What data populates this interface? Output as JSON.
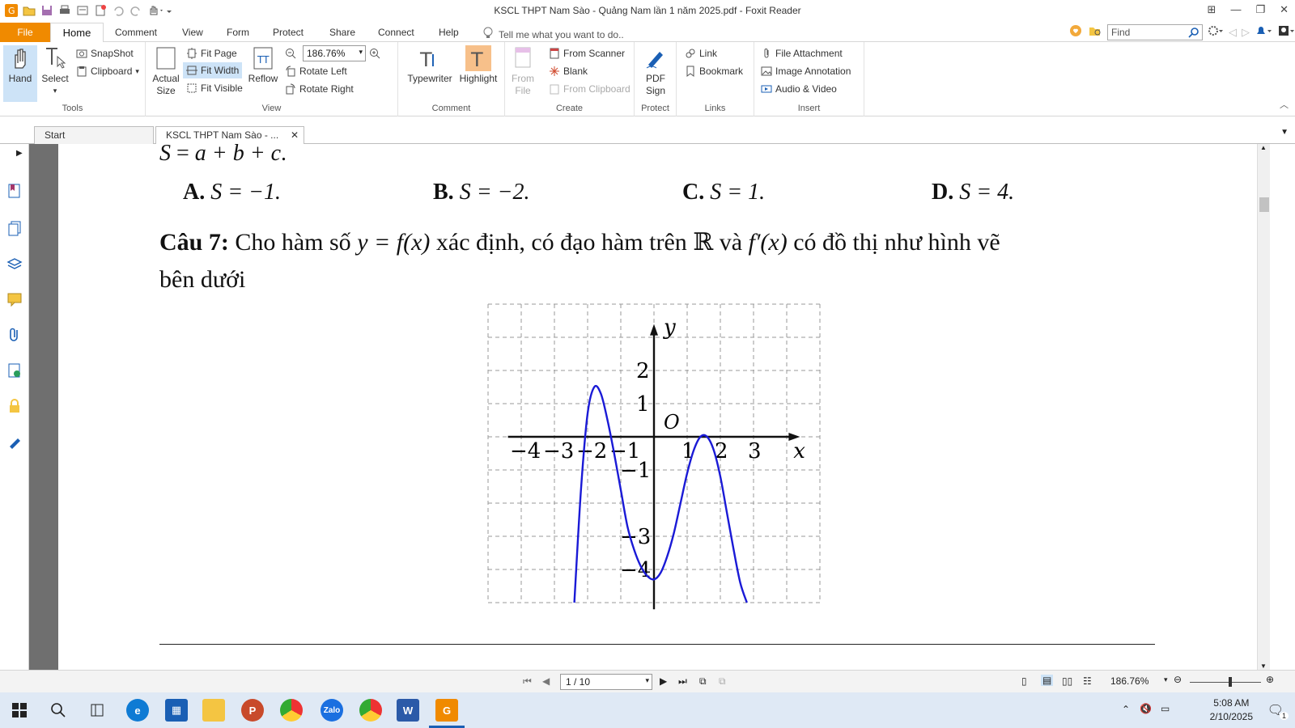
{
  "window": {
    "title": "KSCL THPT Nam Sào - Quảng Nam lần 1 năm 2025.pdf - Foxit Reader"
  },
  "ribbon_tabs": {
    "file": "File",
    "home": "Home",
    "comment": "Comment",
    "view": "View",
    "form": "Form",
    "protect": "Protect",
    "share": "Share",
    "connect": "Connect",
    "help": "Help",
    "tell_me": "Tell me what you want to do..",
    "find_placeholder": "Find"
  },
  "ribbon": {
    "tools": {
      "hand": "Hand",
      "select": "Select",
      "snapshot": "SnapShot",
      "clipboard": "Clipboard",
      "label": "Tools"
    },
    "view": {
      "actual": "Actual",
      "size": "Size",
      "fit_page": "Fit Page",
      "fit_width": "Fit Width",
      "fit_visible": "Fit Visible",
      "reflow": "Reflow",
      "zoom": "186.76%",
      "rotate_left": "Rotate Left",
      "rotate_right": "Rotate Right",
      "label": "View"
    },
    "comment": {
      "typewriter": "Typewriter",
      "highlight": "Highlight",
      "label": "Comment"
    },
    "create": {
      "from": "From",
      "file": "File",
      "from_scanner": "From Scanner",
      "blank": "Blank",
      "from_clipboard": "From Clipboard",
      "label": "Create"
    },
    "protect": {
      "pdf": "PDF",
      "sign": "Sign",
      "label": "Protect"
    },
    "links": {
      "link": "Link",
      "bookmark": "Bookmark",
      "label": "Links"
    },
    "insert": {
      "file_attachment": "File Attachment",
      "image_annotation": "Image Annotation",
      "audio_video": "Audio & Video",
      "label": "Insert"
    }
  },
  "doc_tabs": {
    "start": "Start",
    "current": "KSCL THPT Nam Sào - ..."
  },
  "document": {
    "line1_S": "S",
    "line1_eq": " = ",
    "line1_expr": "a + b + c",
    "line1_end": ".",
    "answers": [
      {
        "letter": "A.",
        "expr": "S = −1."
      },
      {
        "letter": "B.",
        "expr": "S = −2."
      },
      {
        "letter": "C.",
        "expr": "S = 1."
      },
      {
        "letter": "D.",
        "expr": "S = 4."
      }
    ],
    "question_label": "Câu 7:",
    "q_text_1": "Cho hàm số",
    "q_math_1": "y = f(x)",
    "q_text_2": "xác định, có đạo hàm trên ℝ và",
    "q_math_2": "f′(x)",
    "q_text_3": "có đồ thị như hình vẽ",
    "q_line2": "bên dưới"
  },
  "chart_data": {
    "type": "line",
    "xlabel": "x",
    "ylabel": "y",
    "origin_label": "O",
    "x_ticks": [
      "−4",
      "−3",
      "−2",
      "−1",
      "1",
      "2",
      "3"
    ],
    "y_ticks": [
      "2",
      "1",
      "−1",
      "−3",
      "−4"
    ],
    "xlim": [
      -5,
      5
    ],
    "ylim": [
      -5,
      4
    ],
    "grid": true,
    "series": [
      {
        "x": [
          -2.4,
          -2.2,
          -2.0,
          -1.8,
          -1.6,
          -1.4,
          -1.2,
          -1.0,
          -0.8,
          -0.6,
          -0.4,
          -0.2,
          0.0,
          0.2,
          0.4,
          0.6,
          0.8,
          1.0,
          1.2,
          1.4,
          1.6,
          1.8,
          2.0,
          2.2,
          2.4,
          2.6,
          2.8
        ],
        "y": [
          -5.0,
          -1.6,
          0.7,
          1.5,
          1.3,
          0.5,
          -0.5,
          -1.6,
          -2.7,
          -3.4,
          -3.9,
          -4.2,
          -4.3,
          -4.1,
          -3.6,
          -2.9,
          -2.0,
          -1.1,
          -0.4,
          0.0,
          0.0,
          -0.4,
          -1.2,
          -2.3,
          -3.4,
          -4.4,
          -5.0
        ]
      }
    ]
  },
  "status": {
    "page": "1 / 10",
    "zoom": "186.76%"
  },
  "taskbar": {
    "time": "5:08 AM",
    "date": "2/10/2025",
    "notif_count": "1"
  }
}
